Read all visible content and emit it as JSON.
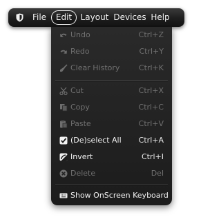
{
  "menubar": {
    "app_icon": "shield-icon",
    "items": [
      {
        "label": "File"
      },
      {
        "label": "Edit"
      },
      {
        "label": "Layout"
      },
      {
        "label": "Devices"
      },
      {
        "label": "Help"
      }
    ],
    "active_item": "Edit"
  },
  "edit_menu": {
    "items": [
      {
        "label": "Undo",
        "shortcut": "Ctrl+Z",
        "icon": "undo-icon",
        "enabled": false
      },
      {
        "label": "Redo",
        "shortcut": "Ctrl+Y",
        "icon": "redo-icon",
        "enabled": false
      },
      {
        "label": "Clear History",
        "shortcut": "Ctrl+K",
        "icon": "broom-icon",
        "enabled": false
      },
      {
        "label": "Cut",
        "shortcut": "Ctrl+X",
        "icon": "scissors-icon",
        "enabled": false
      },
      {
        "label": "Copy",
        "shortcut": "Ctrl+C",
        "icon": "copy-icon",
        "enabled": false
      },
      {
        "label": "Paste",
        "shortcut": "Ctrl+V",
        "icon": "paste-icon",
        "enabled": false
      },
      {
        "label": "(De)select All",
        "shortcut": "Ctrl+A",
        "icon": "checkbox-icon",
        "enabled": true
      },
      {
        "label": "Invert",
        "shortcut": "Ctrl+I",
        "icon": "invert-icon",
        "enabled": true
      },
      {
        "label": "Delete",
        "shortcut": "Del",
        "icon": "delete-icon",
        "enabled": false
      },
      {
        "label": "Show OnScreen Keyboard",
        "shortcut": "",
        "icon": "keyboard-icon",
        "enabled": true
      }
    ]
  },
  "colors": {
    "menu_background": "#222222",
    "enabled_text": "#f2f2f2",
    "disabled_text": "#707070",
    "separator": "#4d4d4d"
  }
}
